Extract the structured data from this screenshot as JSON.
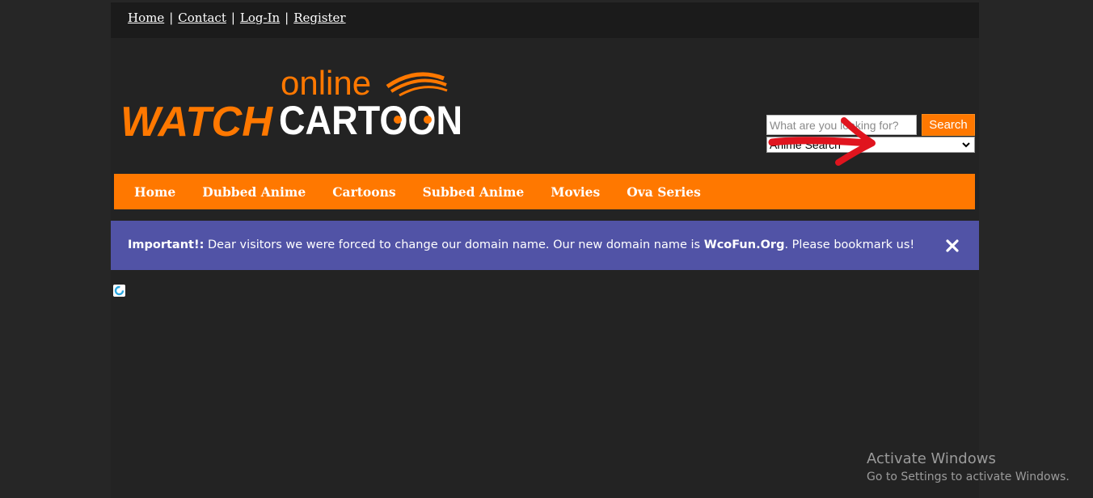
{
  "topbar": {
    "links": [
      "Home",
      "Contact",
      "Log-In",
      "Register"
    ],
    "separator": "|"
  },
  "logo": {
    "line1": "online",
    "word1": "WATCH",
    "word2": "CARTOON",
    "orange": "#ff7800",
    "white": "#ffffff"
  },
  "search": {
    "placeholder": "What are you looking for?",
    "value": "",
    "button_label": "Search",
    "select_value": "Anime Search"
  },
  "nav": {
    "items": [
      "Home",
      "Dubbed Anime",
      "Cartoons",
      "Subbed Anime",
      "Movies",
      "Ova Series"
    ]
  },
  "notice": {
    "label": "Important!:",
    "text_before": " Dear visitors we were forced to change our domain name. Our new domain name is ",
    "domain": "WcoFun.Org",
    "text_after": ". Please bookmark us!"
  },
  "watermark": {
    "title": "Activate Windows",
    "subtitle": "Go to Settings to activate Windows."
  },
  "icons": {
    "close": "close-icon",
    "select": "chevron-down-icon",
    "loading": "loading-spinner-icon",
    "annotation": "red-arrow-icon"
  },
  "colors": {
    "accent": "#ff7800",
    "notice_bg": "#5153a6",
    "page_bg": "#232323",
    "annotation": "#e0141e"
  }
}
